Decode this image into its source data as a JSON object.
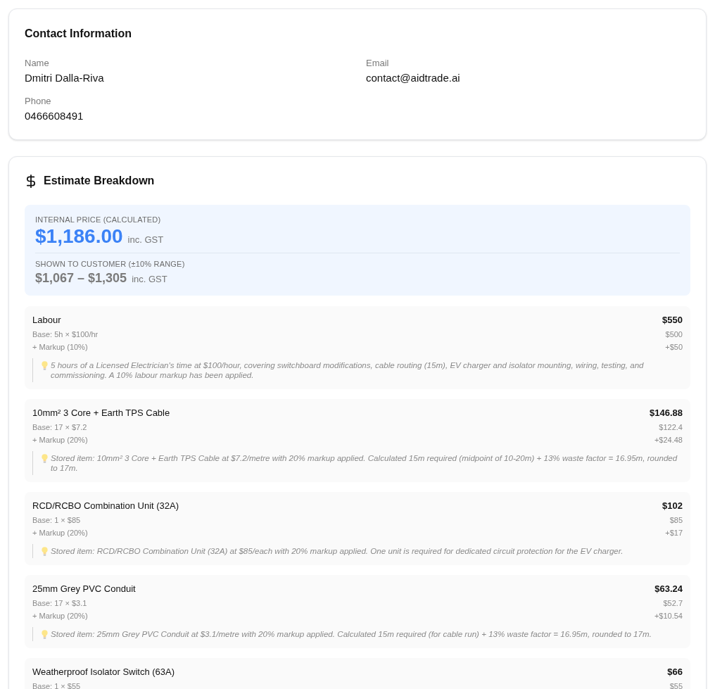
{
  "contact": {
    "title": "Contact Information",
    "fields": [
      {
        "label": "Name",
        "value": "Dmitri Dalla-Riva"
      },
      {
        "label": "Email",
        "value": "contact@aidtrade.ai"
      },
      {
        "label": "Phone",
        "value": "0466608491"
      }
    ]
  },
  "estimate": {
    "title": "Estimate Breakdown",
    "internal_price": {
      "label": "INTERNAL PRICE (CALCULATED)",
      "amount": "$1,186.00",
      "suffix": "inc. GST"
    },
    "customer_range": {
      "label": "SHOWN TO CUSTOMER (±10% RANGE)",
      "amount": "$1,067 – $1,305",
      "suffix": "inc. GST"
    },
    "items": [
      {
        "name": "Labour",
        "total": "$550",
        "lines": [
          {
            "label": "Base: 5h × $100/hr",
            "amount": "$500"
          },
          {
            "label": "+ Markup (10%)",
            "amount": "+$50"
          }
        ],
        "note": "5 hours of a Licensed Electrician's time at $100/hour, covering switchboard modifications, cable routing (15m), EV charger and isolator mounting, wiring, testing, and commissioning. A 10% labour markup has been applied."
      },
      {
        "name": "10mm² 3 Core + Earth TPS Cable",
        "total": "$146.88",
        "lines": [
          {
            "label": "Base: 17 × $7.2",
            "amount": "$122.4"
          },
          {
            "label": "+ Markup (20%)",
            "amount": "+$24.48"
          }
        ],
        "note": "Stored item: 10mm² 3 Core + Earth TPS Cable at $7.2/metre with 20% markup applied. Calculated 15m required (midpoint of 10-20m) + 13% waste factor = 16.95m, rounded to 17m."
      },
      {
        "name": "RCD/RCBO Combination Unit (32A)",
        "total": "$102",
        "lines": [
          {
            "label": "Base: 1 × $85",
            "amount": "$85"
          },
          {
            "label": "+ Markup (20%)",
            "amount": "+$17"
          }
        ],
        "note": "Stored item: RCD/RCBO Combination Unit (32A) at $85/each with 20% markup applied. One unit is required for dedicated circuit protection for the EV charger."
      },
      {
        "name": "25mm Grey PVC Conduit",
        "total": "$63.24",
        "lines": [
          {
            "label": "Base: 17 × $3.1",
            "amount": "$52.7"
          },
          {
            "label": "+ Markup (20%)",
            "amount": "+$10.54"
          }
        ],
        "note": "Stored item: 25mm Grey PVC Conduit at $3.1/metre with 20% markup applied. Calculated 15m required (for cable run) + 13% waste factor = 16.95m, rounded to 17m."
      },
      {
        "name": "Weatherproof Isolator Switch (63A)",
        "total": "$66",
        "lines": [
          {
            "label": "Base: 1 × $55",
            "amount": "$55"
          }
        ]
      }
    ]
  }
}
